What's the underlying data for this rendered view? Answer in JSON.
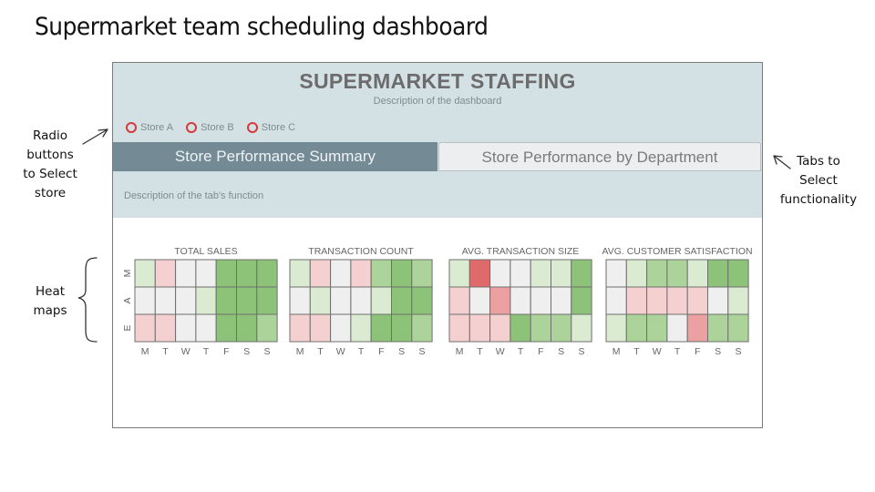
{
  "page_title": "Supermarket team scheduling dashboard",
  "annotations": {
    "radio": [
      "Radio",
      "buttons",
      "to Select",
      "store"
    ],
    "tabs": [
      "Tabs to",
      "Select",
      "functionality"
    ],
    "heat": [
      "Heat",
      "maps"
    ]
  },
  "dashboard": {
    "title": "SUPERMARKET STAFFING",
    "description": "Description of the dashboard",
    "stores": [
      "Store A",
      "Store B",
      "Store C"
    ],
    "tabs": [
      "Store Performance Summary",
      "Store Performance by Department"
    ],
    "active_tab": 0,
    "tab_description": "Description of the tab's function"
  },
  "colors": {
    "accent_radio": "#d9383a",
    "header_band": "#d3e0e4",
    "active_tab": "#748b96",
    "levels": {
      "r3": "#e0696c",
      "r2": "#eca0a2",
      "r1": "#f5d0d1",
      "n": "#efefef",
      "g1": "#daebd2",
      "g2": "#acd49a",
      "g3": "#8cc379"
    }
  },
  "chart_data": [
    {
      "type": "heatmap",
      "title": "TOTAL SALES",
      "x": [
        "M",
        "T",
        "W",
        "T",
        "F",
        "S",
        "S"
      ],
      "y": [
        "M",
        "A",
        "E"
      ],
      "values": [
        [
          "g1",
          "r1",
          "n",
          "n",
          "g3",
          "g3",
          "g3"
        ],
        [
          "n",
          "n",
          "n",
          "g1",
          "g3",
          "g3",
          "g3"
        ],
        [
          "r1",
          "r1",
          "n",
          "n",
          "g3",
          "g3",
          "g2"
        ]
      ]
    },
    {
      "type": "heatmap",
      "title": "TRANSACTION COUNT",
      "x": [
        "M",
        "T",
        "W",
        "T",
        "F",
        "S",
        "S"
      ],
      "y": [
        "M",
        "A",
        "E"
      ],
      "values": [
        [
          "g1",
          "r1",
          "n",
          "r1",
          "g2",
          "g3",
          "g2"
        ],
        [
          "n",
          "g1",
          "n",
          "n",
          "g1",
          "g3",
          "g3"
        ],
        [
          "r1",
          "r1",
          "n",
          "g1",
          "g3",
          "g3",
          "g2"
        ]
      ]
    },
    {
      "type": "heatmap",
      "title": "AVG. TRANSACTION SIZE",
      "x": [
        "M",
        "T",
        "W",
        "T",
        "F",
        "S",
        "S"
      ],
      "y": [
        "M",
        "A",
        "E"
      ],
      "values": [
        [
          "g1",
          "r3",
          "n",
          "n",
          "g1",
          "g1",
          "g3"
        ],
        [
          "r1",
          "n",
          "r2",
          "n",
          "n",
          "n",
          "g3"
        ],
        [
          "r1",
          "r1",
          "r1",
          "g3",
          "g2",
          "g2",
          "g1"
        ]
      ]
    },
    {
      "type": "heatmap",
      "title": "AVG. CUSTOMER SATISFACTION",
      "x": [
        "M",
        "T",
        "W",
        "T",
        "F",
        "S",
        "S"
      ],
      "y": [
        "M",
        "A",
        "E"
      ],
      "values": [
        [
          "n",
          "g1",
          "g2",
          "g2",
          "g1",
          "g3",
          "g3"
        ],
        [
          "n",
          "r1",
          "r1",
          "r1",
          "r1",
          "n",
          "g1"
        ],
        [
          "g1",
          "g2",
          "g2",
          "n",
          "r2",
          "g2",
          "g2"
        ]
      ]
    }
  ]
}
